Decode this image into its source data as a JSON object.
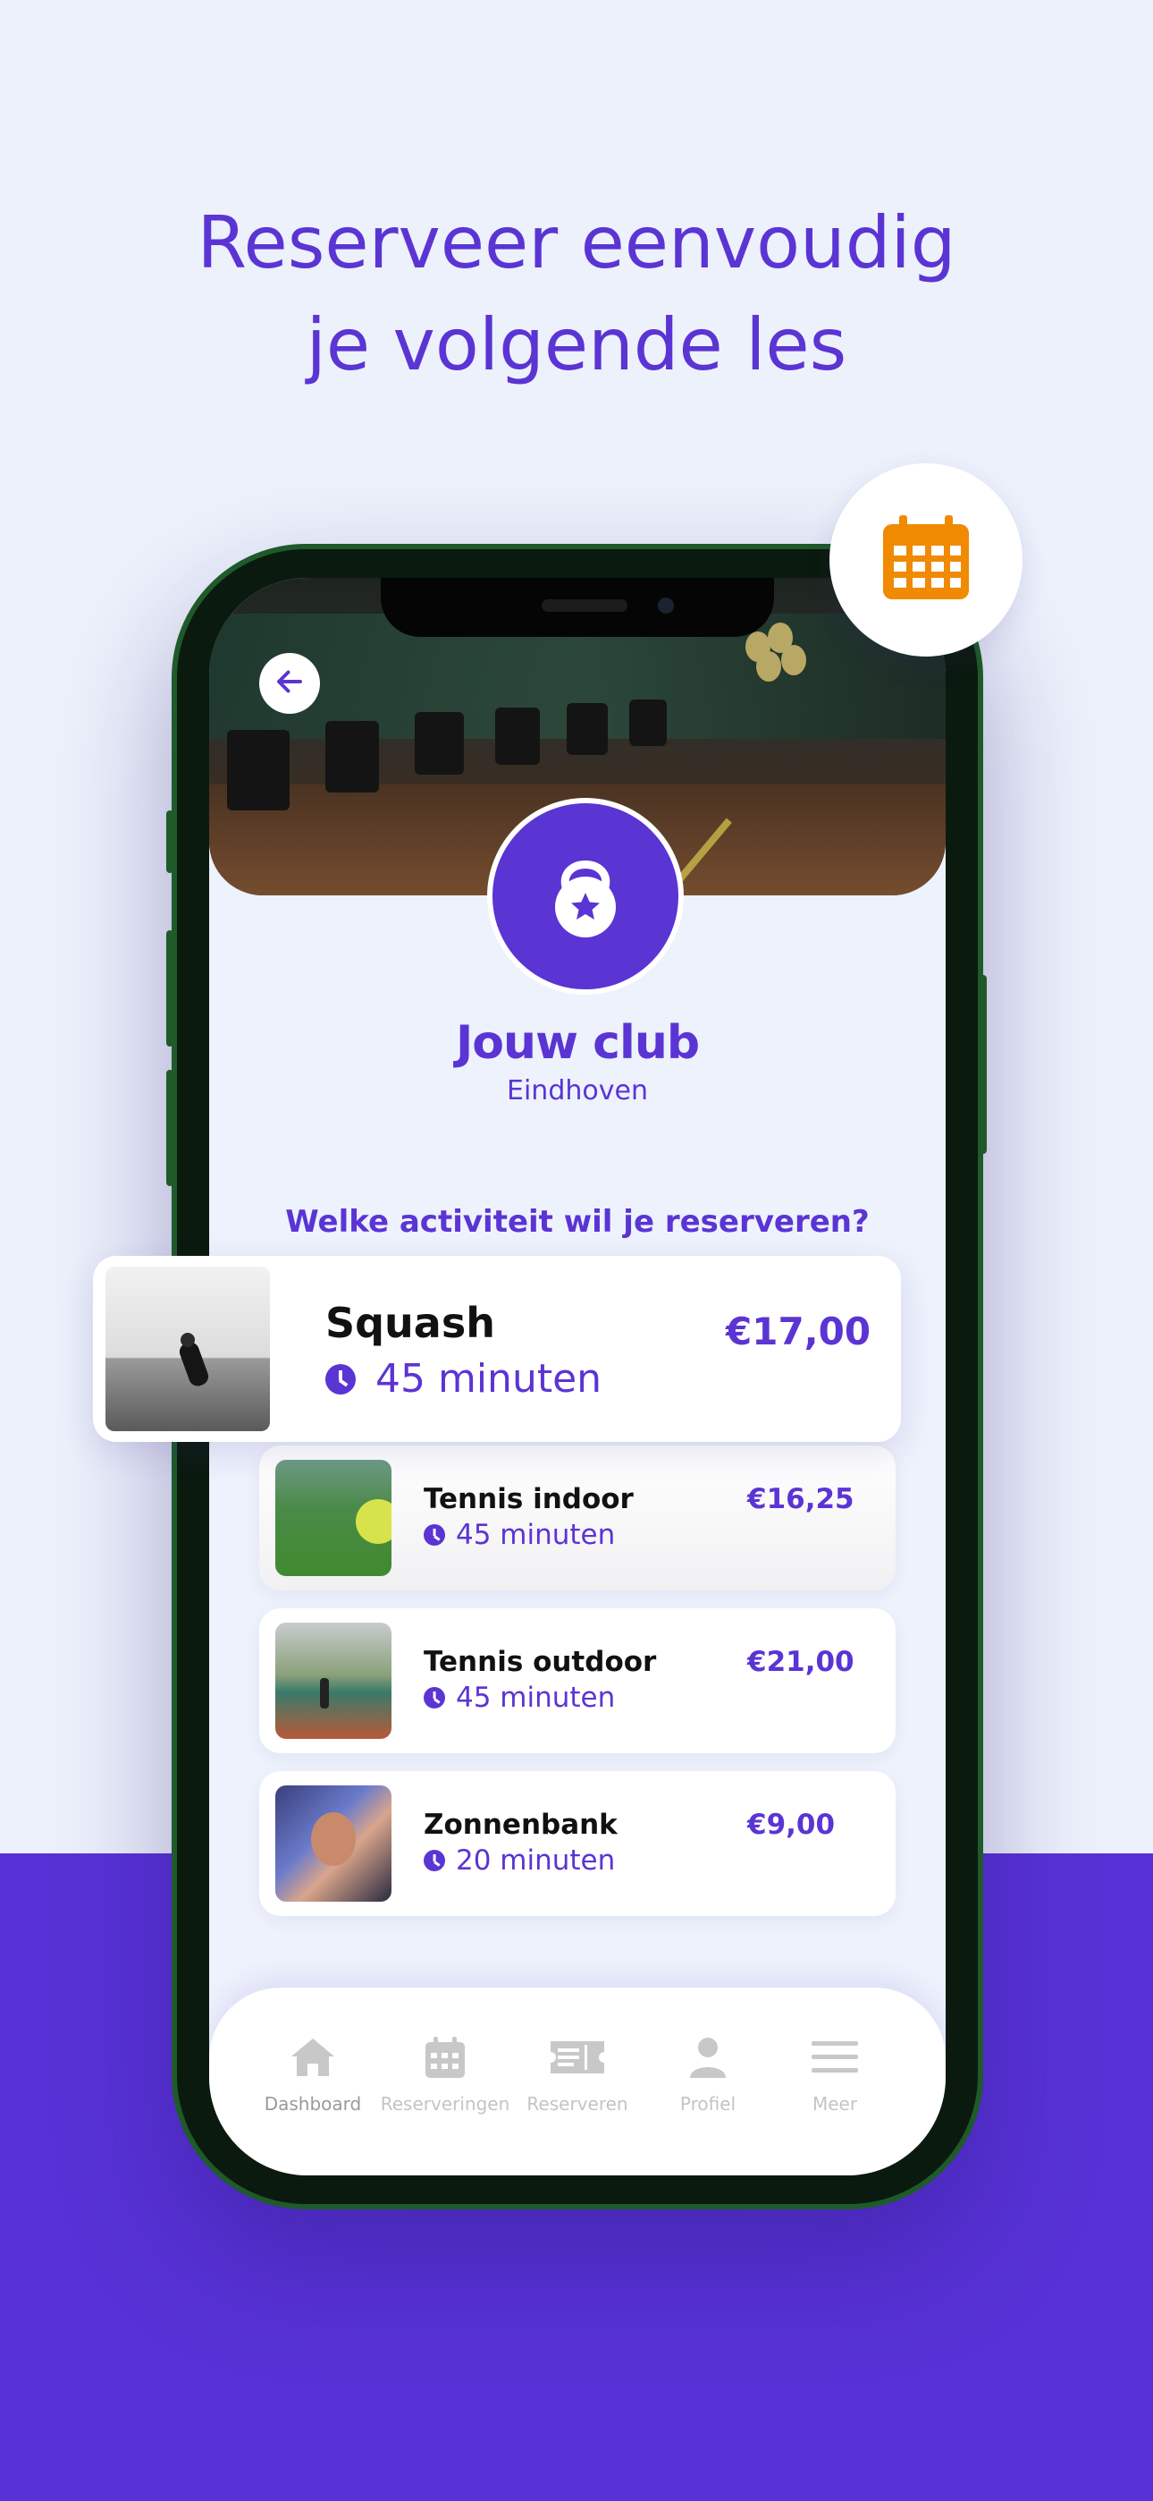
{
  "headline": {
    "line1": "Reserveer eenvoudig",
    "line2": "je volgende les"
  },
  "club": {
    "name": "Jouw club",
    "city": "Eindhoven"
  },
  "question": "Welke activiteit wil je reserveren?",
  "activities": [
    {
      "title": "Squash",
      "duration": "45 minuten",
      "price": "€17,00"
    },
    {
      "title": "Tennis indoor",
      "duration": "45 minuten",
      "price": "€16,25"
    },
    {
      "title": "Tennis outdoor",
      "duration": "45 minuten",
      "price": "€21,00"
    },
    {
      "title": "Zonnenbank",
      "duration": "20 minuten",
      "price": "€9,00"
    }
  ],
  "tabs": [
    {
      "label": "Dashboard",
      "icon": "home-icon",
      "active": true
    },
    {
      "label": "Reserveringen",
      "icon": "calendar-icon",
      "active": false
    },
    {
      "label": "Reserveren",
      "icon": "ticket-icon",
      "active": false
    },
    {
      "label": "Profiel",
      "icon": "user-icon",
      "active": false
    },
    {
      "label": "Meer",
      "icon": "menu-icon",
      "active": false
    }
  ],
  "colors": {
    "brand": "#5b34d4",
    "accent": "#f08a00",
    "band": "#5832d6"
  }
}
